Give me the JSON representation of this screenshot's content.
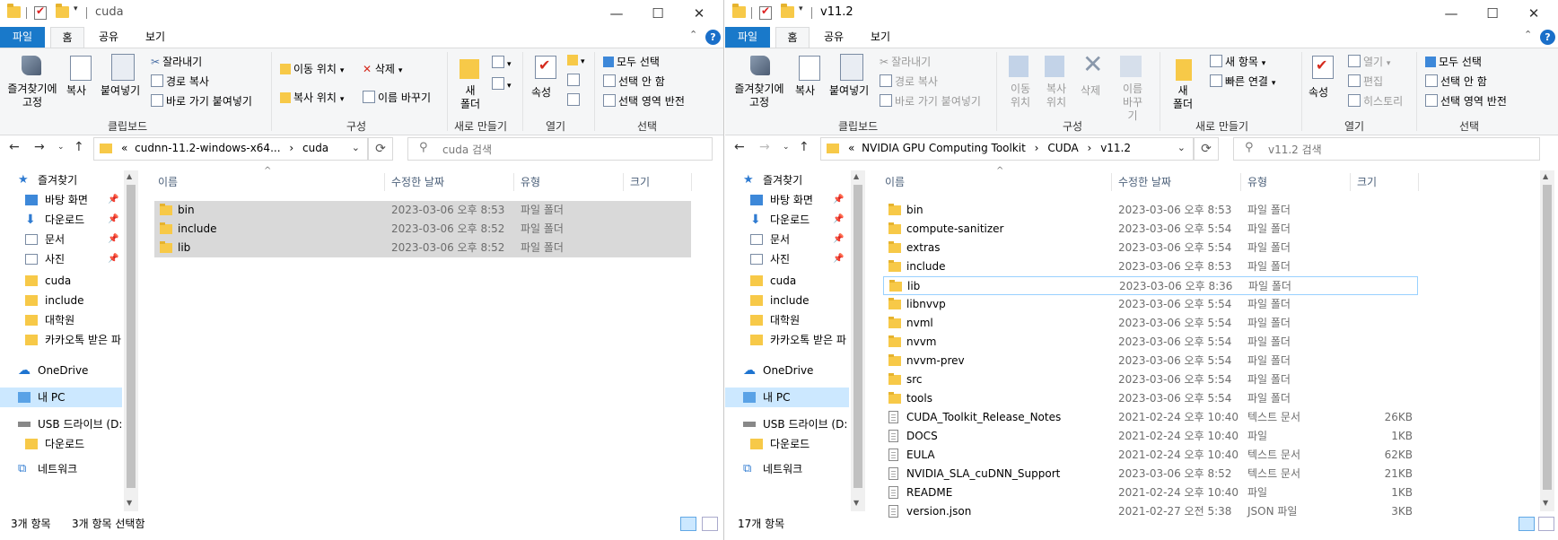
{
  "colors": {
    "accent": "#1979ca",
    "folder": "#f7c948",
    "selected_row": "#d9d9d9",
    "nav_selected": "#cce8ff"
  },
  "ribbon_tabs": [
    "파일",
    "홈",
    "공유",
    "보기"
  ],
  "window_controls": {
    "minimize": "—",
    "maximize": "☐",
    "close": "✕"
  },
  "left_window": {
    "title": "cuda",
    "ribbon": {
      "clipboard": {
        "pin": "즐겨찾기에\n고정",
        "copy": "복사",
        "paste": "붙여넣기",
        "cut": "잘라내기",
        "copy_path": "경로 복사",
        "paste_shortcut": "바로 가기 붙여넣기",
        "label": "클립보드"
      },
      "organize": {
        "move_to": "이동 위치",
        "copy_to": "복사 위치",
        "delete": "삭제",
        "rename": "이름 바꾸기",
        "label": "구성"
      },
      "new": {
        "new_folder": "새\n폴더",
        "label": "새로 만들기"
      },
      "open": {
        "properties": "속성",
        "label": "열기"
      },
      "select": {
        "select_all": "모두 선택",
        "select_none": "선택 안 함",
        "invert": "선택 영역 반전",
        "label": "선택"
      }
    },
    "address": {
      "prefix": "«",
      "path1": "cudnn-11.2-windows-x64...",
      "path2": "cuda"
    },
    "search_placeholder": "cuda 검색",
    "columns": [
      "이름",
      "수정한 날짜",
      "유형",
      "크기"
    ],
    "files": [
      {
        "name": "bin",
        "date": "2023-03-06 오후 8:53",
        "type": "파일 폴더",
        "size": ""
      },
      {
        "name": "include",
        "date": "2023-03-06 오후 8:52",
        "type": "파일 폴더",
        "size": ""
      },
      {
        "name": "lib",
        "date": "2023-03-06 오후 8:52",
        "type": "파일 폴더",
        "size": ""
      }
    ],
    "status": {
      "count": "3개 항목",
      "selected": "3개 항목 선택함"
    }
  },
  "right_window": {
    "title": "v11.2",
    "ribbon": {
      "clipboard": {
        "pin": "즐겨찾기에\n고정",
        "copy": "복사",
        "paste": "붙여넣기",
        "cut": "잘라내기",
        "copy_path": "경로 복사",
        "paste_shortcut": "바로 가기 붙여넣기",
        "label": "클립보드"
      },
      "organize": {
        "move_to": "이동\n위치",
        "copy_to": "복사\n위치",
        "delete": "삭제",
        "rename": "이름\n바꾸기",
        "label": "구성"
      },
      "new": {
        "new_folder": "새\n폴더",
        "new_item": "새 항목",
        "easy_access": "빠른 연결",
        "label": "새로 만들기"
      },
      "open": {
        "properties": "속성",
        "open": "열기",
        "edit": "편집",
        "history": "히스토리",
        "label": "열기"
      },
      "select": {
        "select_all": "모두 선택",
        "select_none": "선택 안 함",
        "invert": "선택 영역 반전",
        "label": "선택"
      }
    },
    "address": {
      "prefix": "«",
      "path1": "NVIDIA GPU Computing Toolkit",
      "path2": "CUDA",
      "path3": "v11.2"
    },
    "search_placeholder": "v11.2 검색",
    "columns": [
      "이름",
      "수정한 날짜",
      "유형",
      "크기"
    ],
    "files": [
      {
        "name": "bin",
        "date": "2023-03-06 오후 8:53",
        "type": "파일 폴더",
        "size": ""
      },
      {
        "name": "compute-sanitizer",
        "date": "2023-03-06 오후 5:54",
        "type": "파일 폴더",
        "size": ""
      },
      {
        "name": "extras",
        "date": "2023-03-06 오후 5:54",
        "type": "파일 폴더",
        "size": ""
      },
      {
        "name": "include",
        "date": "2023-03-06 오후 8:53",
        "type": "파일 폴더",
        "size": ""
      },
      {
        "name": "lib",
        "date": "2023-03-06 오후 8:36",
        "type": "파일 폴더",
        "size": ""
      },
      {
        "name": "libnvvp",
        "date": "2023-03-06 오후 5:54",
        "type": "파일 폴더",
        "size": ""
      },
      {
        "name": "nvml",
        "date": "2023-03-06 오후 5:54",
        "type": "파일 폴더",
        "size": ""
      },
      {
        "name": "nvvm",
        "date": "2023-03-06 오후 5:54",
        "type": "파일 폴더",
        "size": ""
      },
      {
        "name": "nvvm-prev",
        "date": "2023-03-06 오후 5:54",
        "type": "파일 폴더",
        "size": ""
      },
      {
        "name": "src",
        "date": "2023-03-06 오후 5:54",
        "type": "파일 폴더",
        "size": ""
      },
      {
        "name": "tools",
        "date": "2023-03-06 오후 5:54",
        "type": "파일 폴더",
        "size": ""
      },
      {
        "name": "CUDA_Toolkit_Release_Notes",
        "date": "2021-02-24 오후 10:40",
        "type": "텍스트 문서",
        "size": "26KB"
      },
      {
        "name": "DOCS",
        "date": "2021-02-24 오후 10:40",
        "type": "파일",
        "size": "1KB"
      },
      {
        "name": "EULA",
        "date": "2021-02-24 오후 10:40",
        "type": "텍스트 문서",
        "size": "62KB"
      },
      {
        "name": "NVIDIA_SLA_cuDNN_Support",
        "date": "2023-03-06 오후 8:52",
        "type": "텍스트 문서",
        "size": "21KB"
      },
      {
        "name": "README",
        "date": "2021-02-24 오후 10:40",
        "type": "파일",
        "size": "1KB"
      },
      {
        "name": "version.json",
        "date": "2021-02-27 오전 5:38",
        "type": "JSON 파일",
        "size": "3KB"
      }
    ],
    "status": {
      "count": "17개 항목"
    }
  },
  "nav_pane": [
    {
      "label": "즐겨찾기",
      "icon": "star-icon",
      "pinned": false
    },
    {
      "label": "바탕 화면",
      "icon": "desktop-icon",
      "pinned": true
    },
    {
      "label": "다운로드",
      "icon": "download-icon",
      "pinned": true
    },
    {
      "label": "문서",
      "icon": "document-icon",
      "pinned": true
    },
    {
      "label": "사진",
      "icon": "picture-icon",
      "pinned": true
    },
    {
      "label": "cuda",
      "icon": "folder-icon",
      "pinned": false
    },
    {
      "label": "include",
      "icon": "folder-icon",
      "pinned": false
    },
    {
      "label": "대학원",
      "icon": "folder-icon",
      "pinned": false
    },
    {
      "label": "카카오톡 받은 파",
      "icon": "folder-icon",
      "pinned": false
    },
    {
      "label": "OneDrive",
      "icon": "cloud-icon",
      "pinned": false
    },
    {
      "label": "내 PC",
      "icon": "pc-icon",
      "pinned": false
    },
    {
      "label": "USB 드라이브 (D:",
      "icon": "usb-drive-icon",
      "pinned": false
    },
    {
      "label": "다운로드",
      "icon": "folder-icon",
      "pinned": false
    },
    {
      "label": "네트워크",
      "icon": "network-icon",
      "pinned": false
    }
  ]
}
